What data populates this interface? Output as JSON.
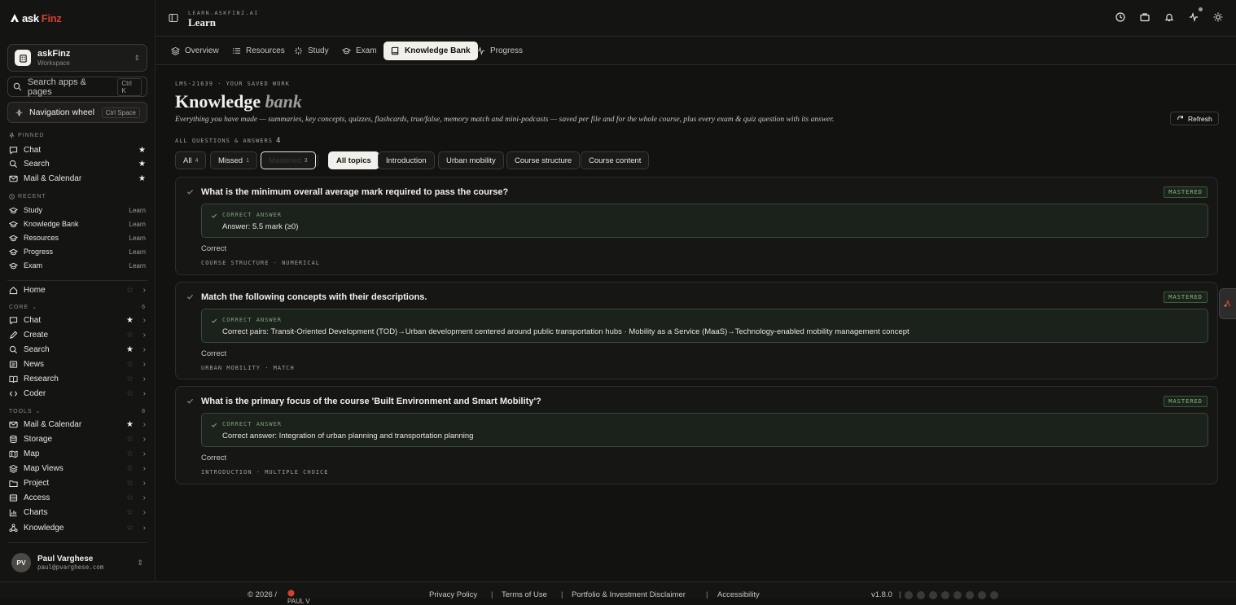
{
  "brand": {
    "name_a": "ask",
    "name_b": "Finz"
  },
  "workspace": {
    "name": "askFinz",
    "subtitle": "Workspace"
  },
  "search": {
    "label": "Search apps & pages",
    "shortcut": "Ctrl K"
  },
  "nav_wheel": {
    "label": "Navigation wheel",
    "shortcut": "Ctrl Space"
  },
  "sidebar": {
    "pinned_label": "PINNED",
    "pinned": [
      {
        "label": "Chat"
      },
      {
        "label": "Search"
      },
      {
        "label": "Mail & Calendar"
      }
    ],
    "recent_label": "RECENT",
    "recent": [
      {
        "label": "Study",
        "tag": "Learn"
      },
      {
        "label": "Knowledge Bank",
        "tag": "Learn"
      },
      {
        "label": "Resources",
        "tag": "Learn"
      },
      {
        "label": "Progress",
        "tag": "Learn"
      },
      {
        "label": "Exam",
        "tag": "Learn"
      }
    ],
    "home": {
      "label": "Home"
    },
    "core_label": "CORE",
    "core_count": "6",
    "core": [
      {
        "label": "Chat",
        "starred": true
      },
      {
        "label": "Create",
        "starred": false
      },
      {
        "label": "Search",
        "starred": true
      },
      {
        "label": "News",
        "starred": false
      },
      {
        "label": "Research",
        "starred": false
      },
      {
        "label": "Coder",
        "starred": false
      }
    ],
    "tools_label": "TOOLS",
    "tools_count": "8",
    "tools": [
      {
        "label": "Mail & Calendar",
        "starred": true
      },
      {
        "label": "Storage",
        "starred": false
      },
      {
        "label": "Map",
        "starred": false
      },
      {
        "label": "Map Views",
        "starred": false
      },
      {
        "label": "Project",
        "starred": false
      },
      {
        "label": "Access",
        "starred": false
      },
      {
        "label": "Charts",
        "starred": false
      },
      {
        "label": "Knowledge",
        "starred": false
      }
    ]
  },
  "user": {
    "initials": "PV",
    "name": "Paul Varghese",
    "email": "paul@pvarghese.com"
  },
  "header": {
    "crumb": "learn.askfinz.ai",
    "title": "Learn"
  },
  "tabs": [
    {
      "label": "Overview",
      "icon": "layers-icon"
    },
    {
      "label": "Resources",
      "icon": "list-icon"
    },
    {
      "label": "Study",
      "icon": "sparkle-icon"
    },
    {
      "label": "Exam",
      "icon": "cap-icon"
    },
    {
      "label": "Knowledge Bank",
      "icon": "book-icon",
      "active": true
    },
    {
      "label": "Progress",
      "icon": "pulse-icon"
    }
  ],
  "page": {
    "pre": "LMS-21639 · YOUR SAVED WORK",
    "title_a": "Knowledge",
    "title_b": "bank",
    "description": "Everything you have made — summaries, key concepts, quizzes, flashcards, true/false, memory match and mini-podcasts — saved per file and for the whole course, plus every exam & quiz question with its answer.",
    "refresh": "Refresh",
    "count_label": "ALL QUESTIONS & ANSWERS",
    "count": "4"
  },
  "filters": {
    "status": [
      {
        "label": "All",
        "count": "4"
      },
      {
        "label": "Missed",
        "count": "1"
      },
      {
        "label": "Mastered",
        "count": "3"
      }
    ],
    "topics": [
      "All topics",
      "Introduction",
      "Urban mobility",
      "Course structure",
      "Course content"
    ]
  },
  "cards": [
    {
      "question": "What is the minimum overall average mark required to pass the course?",
      "badge": "MASTERED",
      "answer_label": "CORRECT ANSWER",
      "answer": "Answer: 5.5 mark (≥0)",
      "result": "Correct",
      "meta": "COURSE STRUCTURE · NUMERICAL"
    },
    {
      "question": "Match the following concepts with their descriptions.",
      "badge": "MASTERED",
      "answer_label": "CORRECT ANSWER",
      "answer": "Correct pairs: Transit-Oriented Development (TOD)→Urban development centered around public transportation hubs · Mobility as a Service (MaaS)→Technology-enabled mobility management concept",
      "result": "Correct",
      "meta": "URBAN MOBILITY · MATCH"
    },
    {
      "question": "What is the primary focus of the course 'Built Environment and Smart Mobility'?",
      "badge": "MASTERED",
      "answer_label": "CORRECT ANSWER",
      "answer": "Correct answer: Integration of urban planning and transportation planning",
      "result": "Correct",
      "meta": "INTRODUCTION · MULTIPLE CHOICE"
    }
  ],
  "footer": {
    "copyright": "© 2026 /",
    "brand": "PAUL V",
    "links": [
      "Privacy Policy",
      "Terms of Use",
      "Portfolio & Investment Disclaimer",
      "Accessibility"
    ],
    "version": "v1.8.0"
  }
}
